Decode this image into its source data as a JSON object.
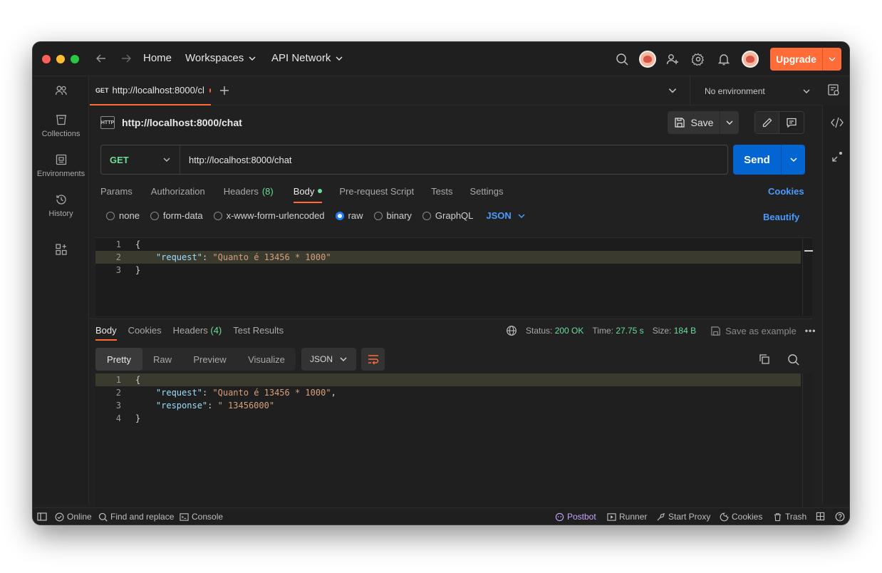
{
  "titlebar": {
    "nav": [
      "Home",
      "Workspaces",
      "API Network"
    ],
    "upgrade_label": "Upgrade"
  },
  "sidebar": {
    "items": [
      {
        "label": ""
      },
      {
        "label": "Collections"
      },
      {
        "label": "Environments"
      },
      {
        "label": "History"
      },
      {
        "label": ""
      }
    ]
  },
  "tab": {
    "method": "GET",
    "title": "http://localhost:8000/cl"
  },
  "environment": {
    "label": "No environment"
  },
  "request": {
    "title": "http://localhost:8000/chat",
    "save_label": "Save",
    "method": "GET",
    "url": "http://localhost:8000/chat",
    "send_label": "Send",
    "tabs": {
      "params": "Params",
      "authorization": "Authorization",
      "headers": "Headers",
      "headers_count": "(8)",
      "body": "Body",
      "prerequest": "Pre-request Script",
      "tests": "Tests",
      "settings": "Settings"
    },
    "cookies_label": "Cookies",
    "body_types": [
      "none",
      "form-data",
      "x-www-form-urlencoded",
      "raw",
      "binary",
      "GraphQL"
    ],
    "selected_body_type": "raw",
    "format": "JSON",
    "beautify_label": "Beautify",
    "body_lines": [
      {
        "num": "1",
        "text": "{"
      },
      {
        "num": "2",
        "key": "\"request\"",
        "value": "\"Quanto é 13456 * 1000\""
      },
      {
        "num": "3",
        "text": "}"
      }
    ]
  },
  "response": {
    "tabs": {
      "body": "Body",
      "cookies": "Cookies",
      "headers": "Headers",
      "headers_count": "(4)",
      "test_results": "Test Results"
    },
    "status_label": "Status:",
    "status_value": "200 OK",
    "time_label": "Time:",
    "time_value": "27.75 s",
    "size_label": "Size:",
    "size_value": "184 B",
    "save_example_label": "Save as example",
    "views": [
      "Pretty",
      "Raw",
      "Preview",
      "Visualize"
    ],
    "active_view": "Pretty",
    "format": "JSON",
    "body_lines": [
      {
        "num": "1",
        "text": "{"
      },
      {
        "num": "2",
        "key": "\"request\"",
        "value": "\"Quanto é 13456 * 1000\"",
        "suffix": ","
      },
      {
        "num": "3",
        "key": "\"response\"",
        "value": "\" 13456000\""
      },
      {
        "num": "4",
        "text": "}"
      }
    ]
  },
  "statusbar": {
    "online": "Online",
    "find_replace": "Find and replace",
    "console": "Console",
    "postbot": "Postbot",
    "runner": "Runner",
    "start_proxy": "Start Proxy",
    "cookies": "Cookies",
    "trash": "Trash"
  },
  "colors": {
    "accent": "#ff6c37",
    "send": "#0265d2",
    "success": "#6bdd9a",
    "link": "#4b9bff"
  }
}
